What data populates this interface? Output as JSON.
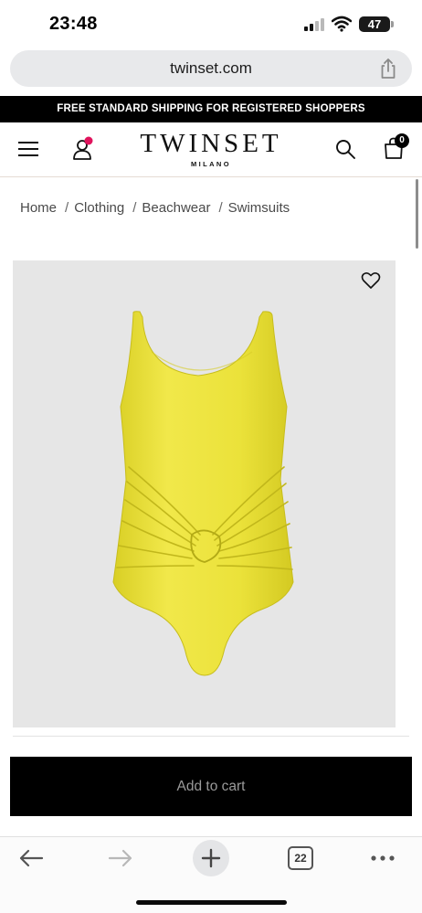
{
  "status_bar": {
    "time": "23:48",
    "battery_level": "47",
    "icons": [
      "signal-icon",
      "wifi-icon",
      "battery-icon"
    ]
  },
  "browser": {
    "url": "twinset.com",
    "open_tabs": "22",
    "share_icon": "share-icon"
  },
  "promo_banner": {
    "text": "FREE STANDARD SHIPPING FOR REGISTERED SHOPPERS"
  },
  "site_header": {
    "logo": "TWINSET",
    "logo_sub": "MILANO",
    "bag_count": "0",
    "icons": [
      "menu-icon",
      "account-icon",
      "search-icon",
      "bag-icon"
    ]
  },
  "breadcrumb": {
    "items": [
      "Home",
      "Clothing",
      "Beachwear",
      "Swimsuits"
    ],
    "separator": "/"
  },
  "product": {
    "image_background": "#e6e6e6",
    "swimsuit_color": "#ede43c",
    "wishlist_icon": "heart-outline-icon",
    "add_to_cart_label": "Add to cart"
  },
  "toolbar": {
    "icons": [
      "back-arrow-icon",
      "forward-arrow-icon",
      "plus-icon",
      "tabs-icon",
      "more-icon"
    ]
  },
  "colors": {
    "brand_black": "#000000",
    "notification_dot": "#e0135c",
    "button_text": "#9a9a9a"
  }
}
